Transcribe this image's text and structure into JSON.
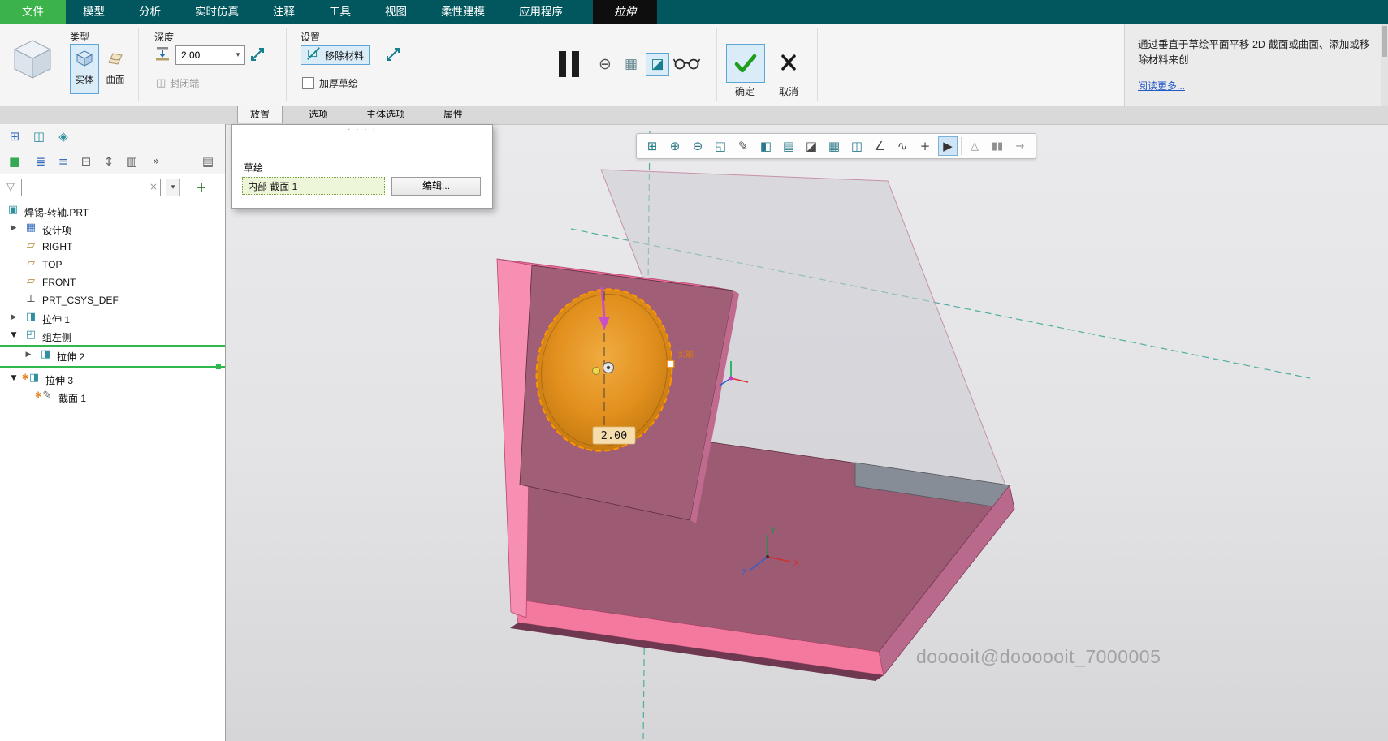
{
  "menubar": {
    "tabs": [
      {
        "label": "文件"
      },
      {
        "label": "模型"
      },
      {
        "label": "分析"
      },
      {
        "label": "实时仿真"
      },
      {
        "label": "注释"
      },
      {
        "label": "工具"
      },
      {
        "label": "视图"
      },
      {
        "label": "柔性建模"
      },
      {
        "label": "应用程序"
      },
      {
        "label": "拉伸"
      }
    ]
  },
  "ribbon": {
    "type_group": {
      "label": "类型",
      "solid_label": "实体",
      "surface_label": "曲面"
    },
    "depth_group": {
      "label": "深度",
      "depth_value": "2.00",
      "closed_end_label": "封闭端"
    },
    "settings_group": {
      "label": "设置",
      "remove_material_label": "移除材料",
      "thicken_label": "加厚草绘"
    },
    "ok_label": "确定",
    "cancel_label": "取消",
    "help_text": "通过垂直于草绘平面平移 2D 截面或曲面、添加或移除材料来创",
    "help_link": "阅读更多..."
  },
  "panel_tabs": {
    "placement": "放置",
    "options": "选项",
    "body_options": "主体选项",
    "properties": "属性"
  },
  "placement_panel": {
    "grip": "· · · ·",
    "section_label": "草绘",
    "sketch_value": "内部 截面 1",
    "edit_label": "编辑..."
  },
  "sidebar": {
    "search_value": "",
    "toolbar_icons": {
      "tree_columns": "⊞",
      "tree_style": "◫",
      "favorites": "◈",
      "show": "■",
      "list_expand": "≣",
      "list_collapse": "≡",
      "group_by": "⊟",
      "sort": "↕",
      "columns": "▥",
      "more": "»",
      "page_setup": "▤",
      "funnel": "▽",
      "clear": "×",
      "caret": "▾",
      "add": "+"
    },
    "tree": {
      "expander_collapsed": "▶",
      "expander_expanded": "▼",
      "modified_marker": "∗",
      "icons": {
        "part": "▣",
        "design_items": "▦",
        "datum_plane": "▱",
        "csys": "⊥",
        "extrude": "◨",
        "group": "◰",
        "sketch": "✎"
      },
      "items": [
        {
          "label": "焊锡-转轴.PRT"
        },
        {
          "label": "设计项"
        },
        {
          "label": "RIGHT"
        },
        {
          "label": "TOP"
        },
        {
          "label": "FRONT"
        },
        {
          "label": "PRT_CSYS_DEF"
        },
        {
          "label": "拉伸 1"
        },
        {
          "label": "组左侧"
        },
        {
          "label": "拉伸 2"
        },
        {
          "label": "拉伸 3"
        },
        {
          "label": "截面 1"
        }
      ]
    }
  },
  "viewport_toolbar": {
    "items": [
      {
        "name": "zoom-window",
        "glyph": "⊞"
      },
      {
        "name": "zoom-in",
        "glyph": "⊕"
      },
      {
        "name": "zoom-out",
        "glyph": "⊖"
      },
      {
        "name": "refit",
        "glyph": "◱"
      },
      {
        "name": "repaint",
        "glyph": "✎"
      },
      {
        "name": "display-style",
        "glyph": "◧"
      },
      {
        "name": "saved-views",
        "glyph": "▤"
      },
      {
        "name": "perspective",
        "glyph": "◪"
      },
      {
        "name": "capture",
        "glyph": "▦"
      },
      {
        "name": "view-manager",
        "glyph": "◫"
      },
      {
        "name": "datum-display",
        "glyph": "∠"
      },
      {
        "name": "annotation-display",
        "glyph": "∿"
      },
      {
        "name": "spin-center",
        "glyph": "+"
      },
      {
        "name": "selection-filter",
        "glyph": "▶"
      },
      {
        "name": "analysis",
        "glyph": "△"
      },
      {
        "name": "pause",
        "glyph": "▮▮"
      },
      {
        "name": "exit",
        "glyph": "→"
      }
    ]
  },
  "viewport": {
    "dimension": "2.00",
    "handle_label": "实前",
    "watermark": "dooooit@doooooit_7000005",
    "axis_x": "X",
    "axis_y": "Y",
    "axis_z": "Z"
  },
  "colors": {
    "menubar_teal": "#01575d",
    "file_tab_green": "#3cb24a",
    "selection_green": "#2eb84d",
    "highlight_blue": "#d9ecf8",
    "model_pink": "#f4799f",
    "model_maroon": "#9c5b73",
    "preview_orange": "#e2901e"
  }
}
